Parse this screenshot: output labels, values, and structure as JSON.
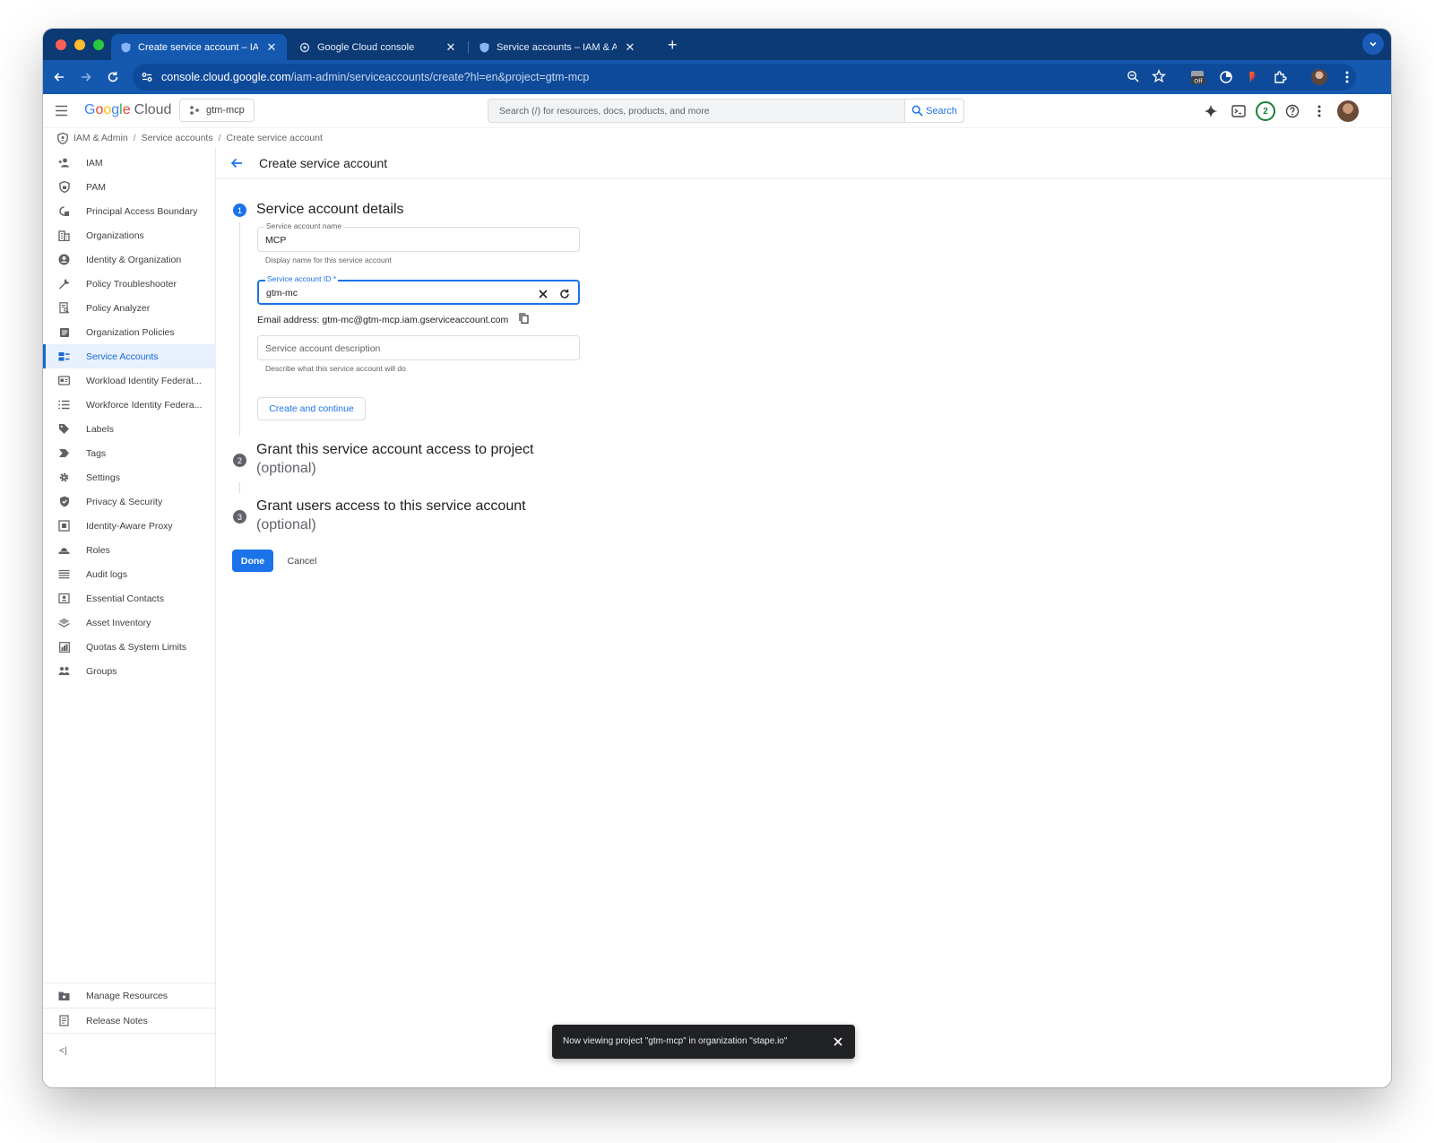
{
  "browser": {
    "tabs": [
      {
        "label": "Create service account – IAM"
      },
      {
        "label": "Google Cloud console"
      },
      {
        "label": "Service accounts – IAM & Ad"
      }
    ],
    "new_tab": "+",
    "url_host": "console.cloud.google.com",
    "url_path": "/iam-admin/serviceaccounts/create?hl=en&project=gtm-mcp",
    "extension_badge": "Off"
  },
  "header": {
    "logo_letters": [
      "G",
      "o",
      "o",
      "g",
      "l",
      "e"
    ],
    "logo_product": "Cloud",
    "project": "gtm-mcp",
    "search_placeholder": "Search (/) for resources, docs, products, and more",
    "search_button": "Search",
    "notifications_count": "2"
  },
  "breadcrumb": [
    "IAM & Admin",
    "Service accounts",
    "Create service account"
  ],
  "sidebar": {
    "items": [
      {
        "label": "IAM"
      },
      {
        "label": "PAM"
      },
      {
        "label": "Principal Access Boundary"
      },
      {
        "label": "Organizations"
      },
      {
        "label": "Identity & Organization"
      },
      {
        "label": "Policy Troubleshooter"
      },
      {
        "label": "Policy Analyzer"
      },
      {
        "label": "Organization Policies"
      },
      {
        "label": "Service Accounts"
      },
      {
        "label": "Workload Identity Federat..."
      },
      {
        "label": "Workforce Identity Federa..."
      },
      {
        "label": "Labels"
      },
      {
        "label": "Tags"
      },
      {
        "label": "Settings"
      },
      {
        "label": "Privacy & Security"
      },
      {
        "label": "Identity-Aware Proxy"
      },
      {
        "label": "Roles"
      },
      {
        "label": "Audit logs"
      },
      {
        "label": "Essential Contacts"
      },
      {
        "label": "Asset Inventory"
      },
      {
        "label": "Quotas & System Limits"
      },
      {
        "label": "Groups"
      }
    ],
    "footer": [
      {
        "label": "Manage Resources"
      },
      {
        "label": "Release Notes"
      }
    ],
    "collapse": "<|"
  },
  "main": {
    "title": "Create service account",
    "step1": {
      "number": "1",
      "title": "Service account details",
      "name_label": "Service account name",
      "name_value": "MCP",
      "name_helper": "Display name for this service account",
      "id_label": "Service account ID *",
      "id_value": "gtm-mc",
      "email": "Email address: gtm-mc@gtm-mcp.iam.gserviceaccount.com",
      "desc_placeholder": "Service account description",
      "desc_helper": "Describe what this service account will do",
      "create_button": "Create and continue"
    },
    "step2": {
      "number": "2",
      "title": "Grant this service account access to project",
      "optional": "(optional)"
    },
    "step3": {
      "number": "3",
      "title": "Grant users access to this service account",
      "optional": "(optional)"
    },
    "done_button": "Done",
    "cancel_button": "Cancel"
  },
  "snackbar": {
    "message": "Now viewing project \"gtm-mcp\" in organization \"stape.io\""
  },
  "colors": {
    "tabstrip": "#0b3a74",
    "toolbar": "#1558b0",
    "accent": "#1a73e8",
    "sidebar_active_bg": "#e8f0fe"
  }
}
